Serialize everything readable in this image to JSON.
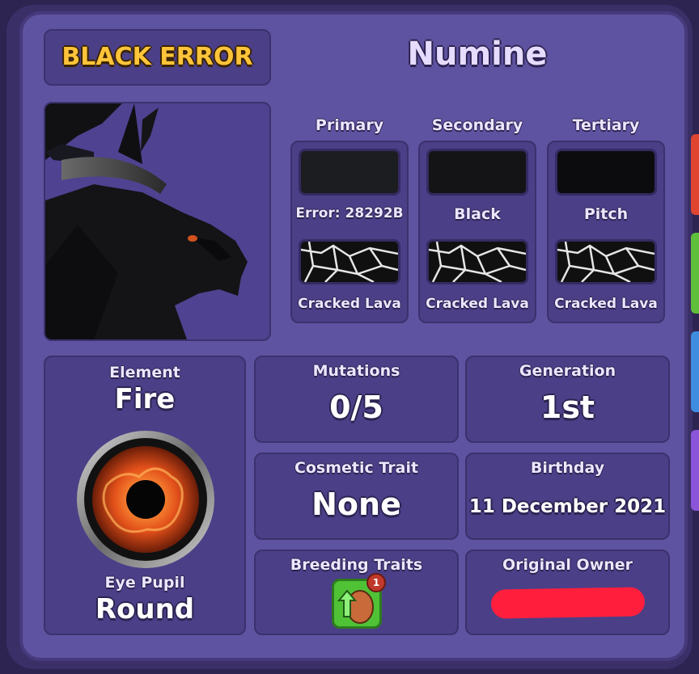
{
  "header": {
    "rarity": "BLACK ERROR",
    "dragon_name": "Numine"
  },
  "colors": {
    "columns": [
      {
        "label": "Primary",
        "color_name": "Error: 28292B",
        "hex": "#1b1d20",
        "pattern": "Cracked Lava"
      },
      {
        "label": "Secondary",
        "color_name": "Black",
        "hex": "#141417",
        "pattern": "Cracked Lava"
      },
      {
        "label": "Tertiary",
        "color_name": "Pitch",
        "hex": "#0c0c0e",
        "pattern": "Cracked Lava"
      }
    ]
  },
  "element": {
    "label": "Element",
    "value": "Fire"
  },
  "eye": {
    "label": "Eye Pupil",
    "value": "Round"
  },
  "mutations": {
    "label": "Mutations",
    "value": "0/5"
  },
  "generation": {
    "label": "Generation",
    "value": "1st"
  },
  "cosmetic": {
    "label": "Cosmetic Trait",
    "value": "None"
  },
  "birthday": {
    "label": "Birthday",
    "value": "11 December 2021"
  },
  "breeding": {
    "label": "Breeding Traits",
    "badge": "1",
    "icon": "breeding-trait-icon"
  },
  "owner": {
    "label": "Original Owner"
  },
  "accent_colors": {
    "rarity": "#ffc43a",
    "panel": "#5e53a0",
    "box": "#4b3f87"
  }
}
